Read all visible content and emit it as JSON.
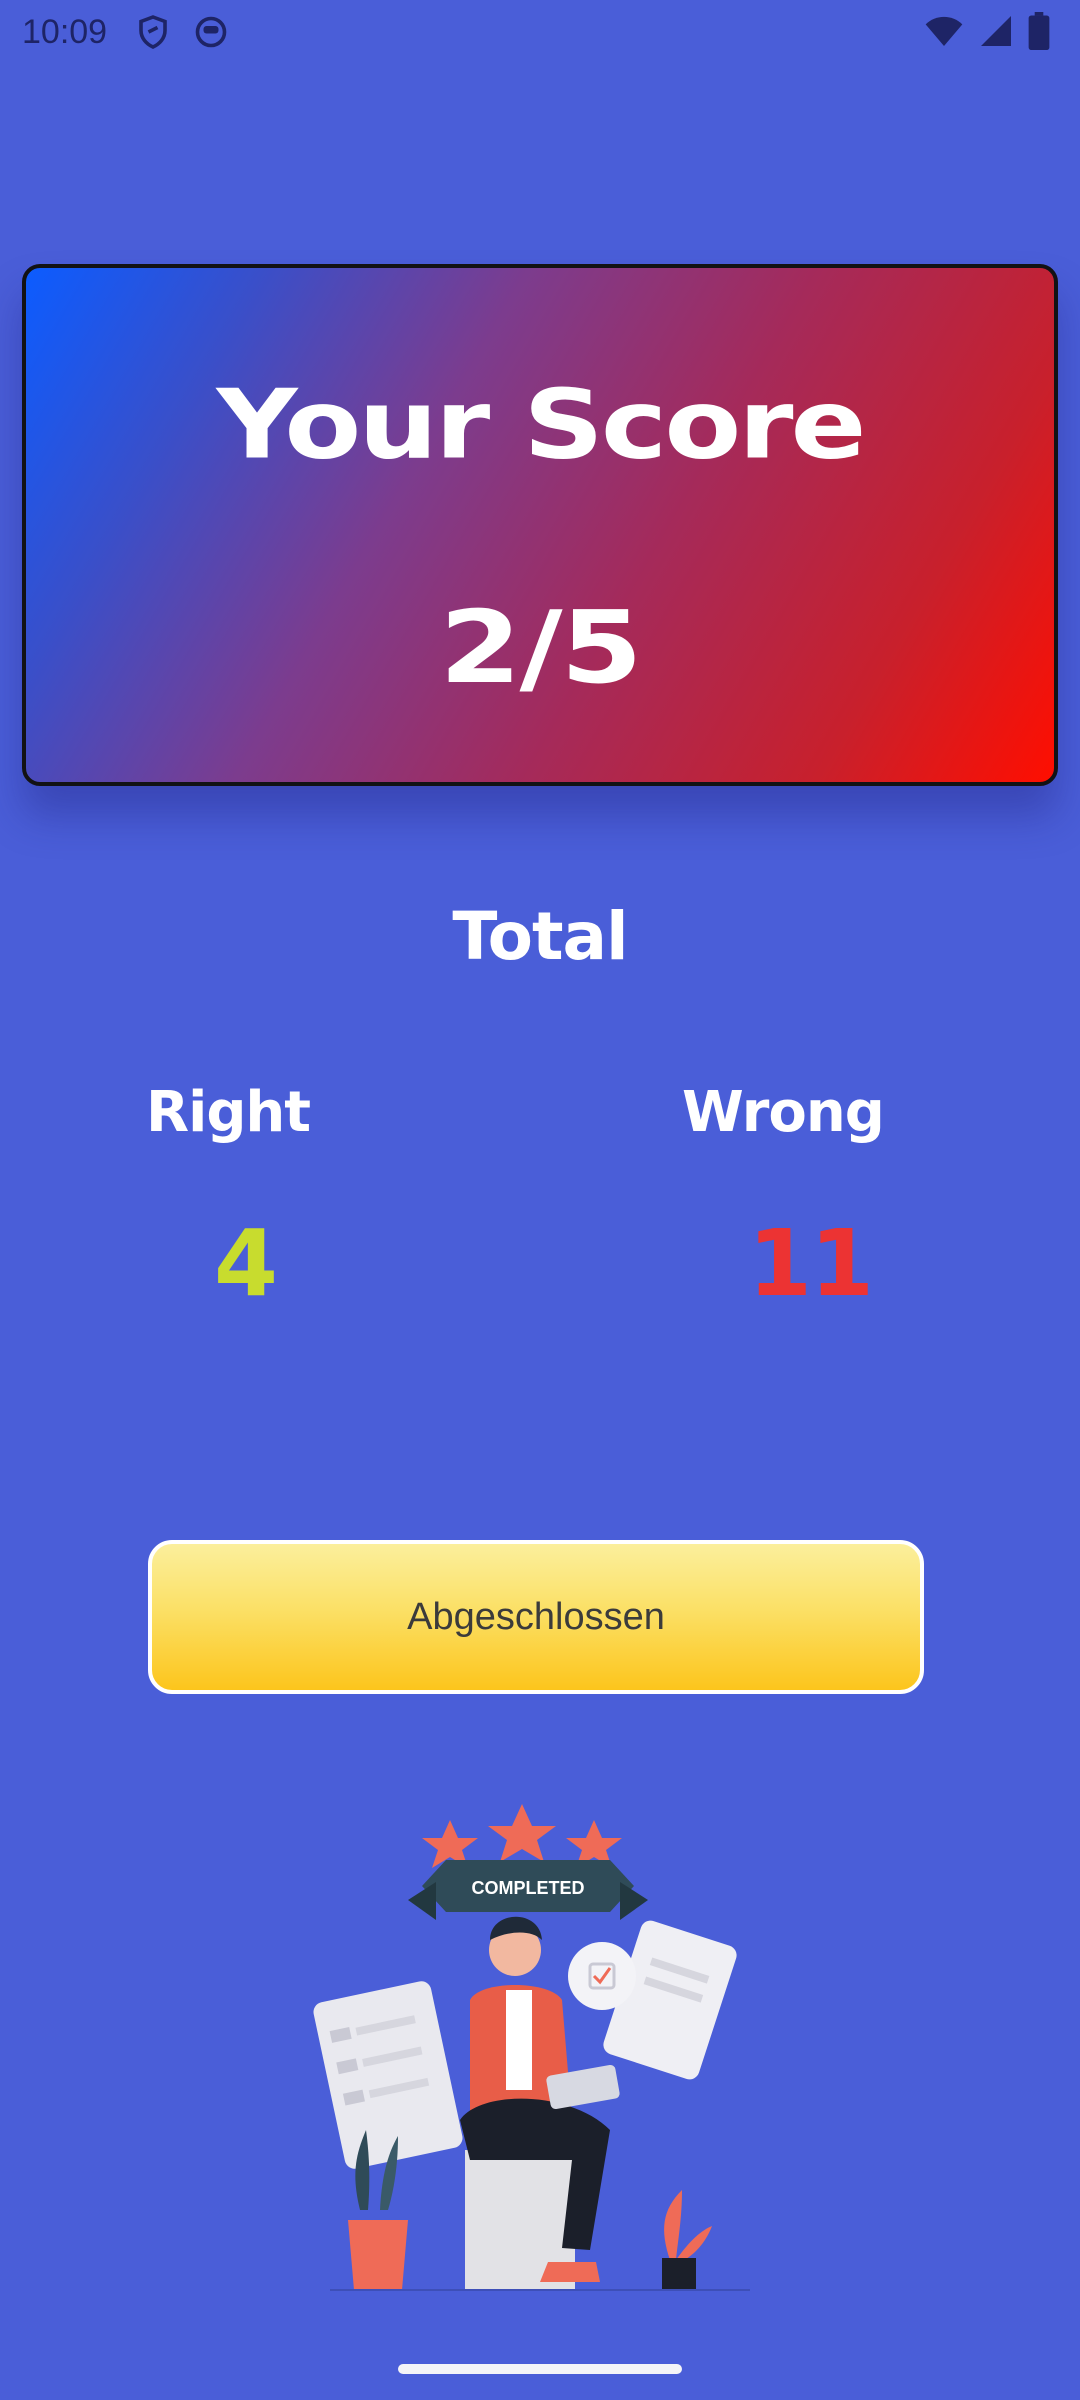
{
  "status_bar": {
    "time": "10:09",
    "icons": [
      "shield-icon",
      "face-icon",
      "wifi-icon",
      "signal-icon",
      "battery-icon"
    ]
  },
  "score_card": {
    "title": "Your Score",
    "score": "2/5"
  },
  "totals": {
    "label": "Total",
    "right_label": "Right",
    "right_value": "4",
    "wrong_label": "Wrong",
    "wrong_value": "11"
  },
  "actions": {
    "done_label": "Abgeschlossen"
  },
  "illustration": {
    "banner_text": "COMPLETED",
    "icon": "completed-illustration"
  },
  "colors": {
    "background": "#4a5ed8",
    "right": "#c8dc2e",
    "wrong": "#ec3333",
    "button": "#fcc51c"
  }
}
